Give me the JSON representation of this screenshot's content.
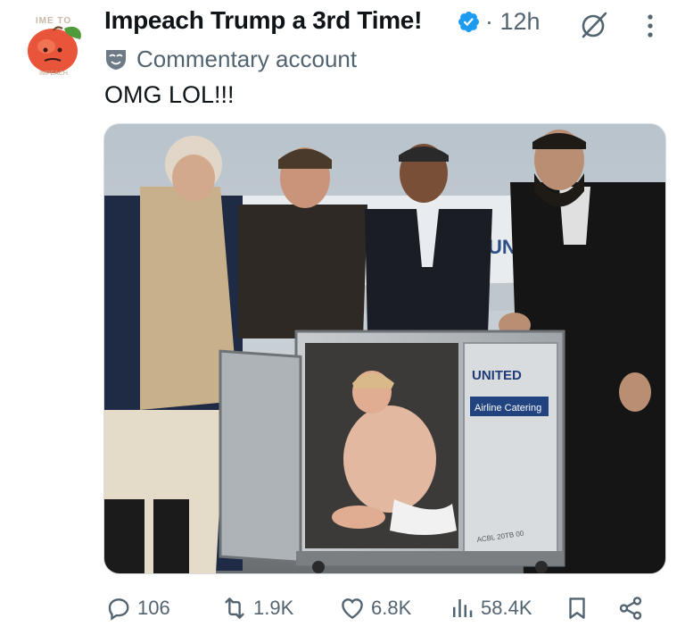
{
  "post": {
    "display_name": "Impeach Trump a 3rd Time!",
    "time_sep": "·",
    "time": "12h",
    "label": "Commentary account",
    "text": "OMG LOL!!!",
    "avatar": {
      "top_text": "IME TO",
      "bottom_text": "IMPEACH"
    },
    "media": {
      "sign_line1": "UNITED",
      "sign_line2": "Airline Catering",
      "plane_text": "UN",
      "cart_serial": "ACBL 20TB 00"
    }
  },
  "actions": {
    "replies": "106",
    "reposts": "1.9K",
    "likes": "6.8K",
    "views": "58.4K"
  },
  "colors": {
    "verified": "#1d9bf0",
    "secondary_text": "#536471",
    "primary_text": "#0f1419"
  },
  "icons": [
    "verified-badge-icon",
    "grok-icon",
    "more-icon",
    "commentary-label-icon",
    "reply-icon",
    "repost-icon",
    "like-icon",
    "views-icon",
    "bookmark-icon",
    "share-icon"
  ]
}
